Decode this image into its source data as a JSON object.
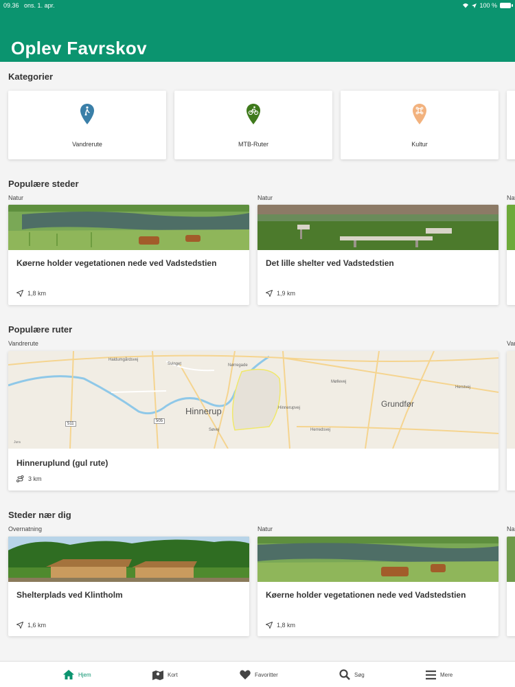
{
  "status_bar": {
    "time": "09.36",
    "date": "ons. 1. apr.",
    "battery": "100 %"
  },
  "header": {
    "title": "Oplev Favrskov"
  },
  "sections": {
    "categories": "Kategorier",
    "popular_places": "Populære steder",
    "popular_routes": "Populære ruter",
    "nearby": "Steder nær dig"
  },
  "categories": [
    {
      "label": "Vandrerute",
      "color": "#3a7fa8",
      "icon": "hiker-icon"
    },
    {
      "label": "MTB-Ruter",
      "color": "#3f7a1c",
      "icon": "bike-icon"
    },
    {
      "label": "Kultur",
      "color": "#f2b27e",
      "icon": "culture-icon"
    }
  ],
  "popular_places": [
    {
      "category": "Natur",
      "title": "Køerne holder vegetationen nede ved Vadstedstien",
      "distance": "1,8 km"
    },
    {
      "category": "Natur",
      "title": "Det lille shelter ved Vadstedstien",
      "distance": "1,9 km"
    }
  ],
  "peek_category": "Natur",
  "popular_routes": [
    {
      "category": "Vandrerute",
      "title": "Hinneruplund (gul rute)",
      "length": "3 km"
    }
  ],
  "route_peek_category": "Van",
  "map": {
    "town1": "Hinnerup",
    "town2": "Grundfør",
    "roads": [
      "Haldumgårdsvej",
      "Svinget",
      "Nørregade",
      "Møllevej",
      "Herstvej",
      "Herredsvej",
      "Hinnerupvej",
      "Søvej"
    ],
    "road_num1": "511",
    "road_num2": "505",
    "attribution": "Jura"
  },
  "nearby": [
    {
      "category": "Overnatning",
      "title": "Shelterplads ved Klintholm",
      "distance": "1,6 km"
    },
    {
      "category": "Natur",
      "title": "Køerne holder vegetationen nede ved Vadstedstien",
      "distance": "1,8 km"
    }
  ],
  "nearby_peek_category": "Na",
  "tabbar": [
    {
      "label": "Hjem",
      "icon": "home-icon",
      "active": true
    },
    {
      "label": "Kort",
      "icon": "map-icon"
    },
    {
      "label": "Favoritter",
      "icon": "heart-icon"
    },
    {
      "label": "Søg",
      "icon": "search-icon"
    },
    {
      "label": "Mere",
      "icon": "menu-icon"
    }
  ],
  "colors": {
    "brand": "#0b946f",
    "background": "#f4f4f4"
  }
}
